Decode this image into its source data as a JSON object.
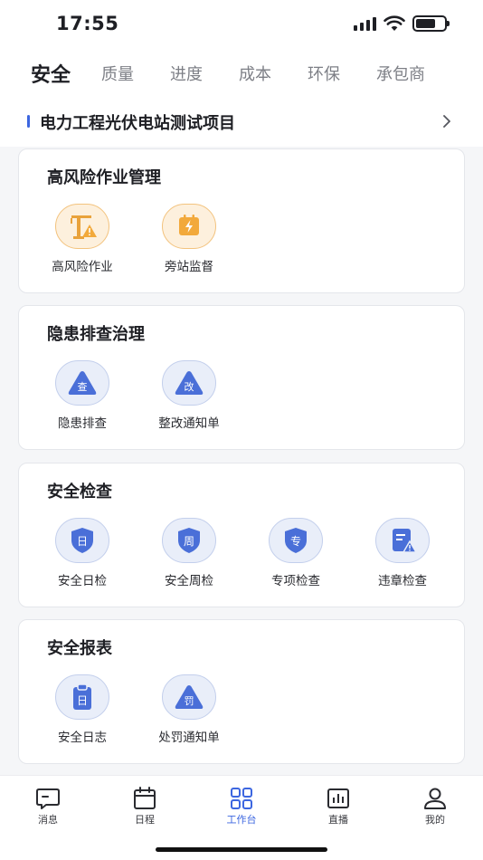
{
  "status_bar": {
    "time": "17:55"
  },
  "tabs": [
    {
      "label": "安全",
      "active": true
    },
    {
      "label": "质量",
      "active": false
    },
    {
      "label": "进度",
      "active": false
    },
    {
      "label": "成本",
      "active": false
    },
    {
      "label": "环保",
      "active": false
    },
    {
      "label": "承包商",
      "active": false
    }
  ],
  "project": {
    "title": "电力工程光伏电站测试项目"
  },
  "sections": [
    {
      "title": "高风险作业管理",
      "items": [
        {
          "label": "高风险作业",
          "icon": "crane-warning-icon"
        },
        {
          "label": "旁站监督",
          "icon": "lightning-badge-icon"
        }
      ]
    },
    {
      "title": "隐患排查治理",
      "items": [
        {
          "label": "隐患排查",
          "icon": "check-triangle-icon",
          "glyph": "查"
        },
        {
          "label": "整改通知单",
          "icon": "rectify-triangle-icon",
          "glyph": "改"
        }
      ]
    },
    {
      "title": "安全检查",
      "items": [
        {
          "label": "安全日检",
          "icon": "daily-shield-icon",
          "glyph": "日"
        },
        {
          "label": "安全周检",
          "icon": "weekly-shield-icon",
          "glyph": "周"
        },
        {
          "label": "专项检查",
          "icon": "special-shield-icon",
          "glyph": "专"
        },
        {
          "label": "违章检查",
          "icon": "violation-doc-icon"
        }
      ]
    },
    {
      "title": "安全报表",
      "items": [
        {
          "label": "安全日志",
          "icon": "log-clipboard-icon",
          "glyph": "日"
        },
        {
          "label": "处罚通知单",
          "icon": "penalty-triangle-icon",
          "glyph": "罚"
        }
      ]
    }
  ],
  "bottom_nav": [
    {
      "label": "消息",
      "icon": "message-icon",
      "active": false
    },
    {
      "label": "日程",
      "icon": "calendar-icon",
      "active": false
    },
    {
      "label": "工作台",
      "icon": "grid-icon",
      "active": true
    },
    {
      "label": "直播",
      "icon": "live-chart-icon",
      "active": false
    },
    {
      "label": "我的",
      "icon": "user-icon",
      "active": false
    }
  ],
  "colors": {
    "accent": "#3c66e0",
    "orange": "#f2a93b",
    "icon_blue": "#4a6fd8"
  }
}
